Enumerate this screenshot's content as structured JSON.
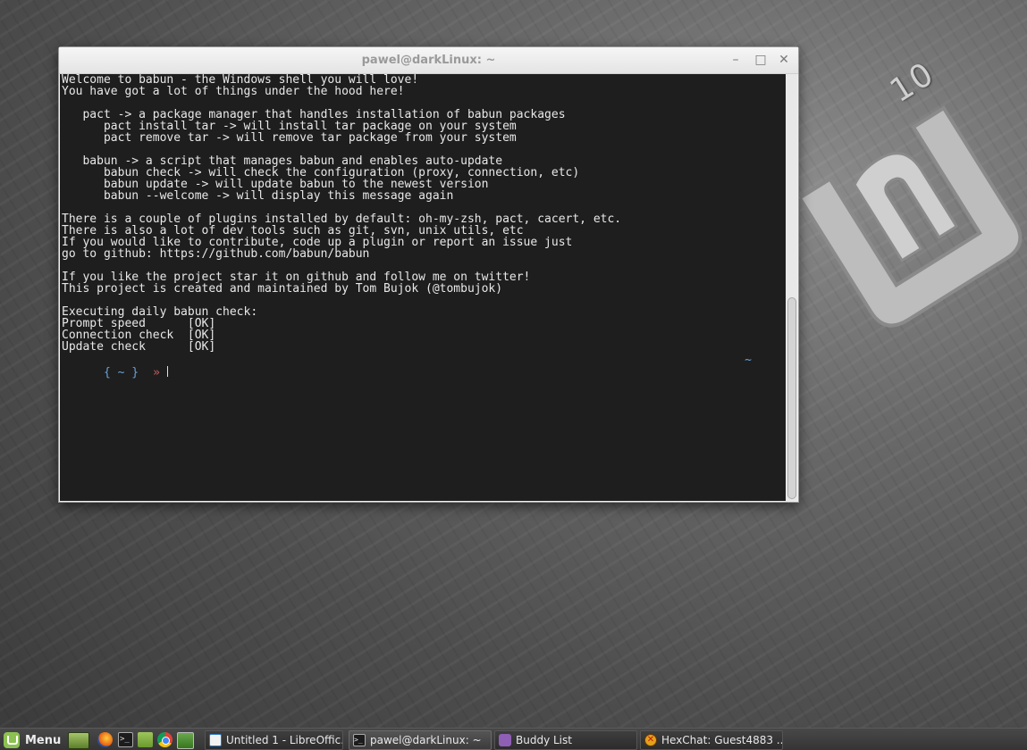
{
  "desktop": {
    "logo_version": "10"
  },
  "window": {
    "title": "pawel@darkLinux: ~",
    "buttons": {
      "minimize": "–",
      "maximize": "□",
      "close": "✕"
    }
  },
  "terminal": {
    "lines": [
      "Welcome to babun - the Windows shell you will love!",
      "You have got a lot of things under the hood here!",
      "",
      "   pact -> a package manager that handles installation of babun packages",
      "      pact install tar -> will install tar package on your system",
      "      pact remove tar -> will remove tar package from your system",
      "",
      "   babun -> a script that manages babun and enables auto-update",
      "      babun check -> will check the configuration (proxy, connection, etc)",
      "      babun update -> will update babun to the newest version",
      "      babun --welcome -> will display this message again",
      "",
      "There is a couple of plugins installed by default: oh-my-zsh, pact, cacert, etc.",
      "There is also a lot of dev tools such as git, svn, unix utils, etc",
      "If you would like to contribute, code up a plugin or report an issue just",
      "go to github: https://github.com/babun/babun",
      "",
      "If you like the project star it on github and follow me on twitter!",
      "This project is created and maintained by Tom Bujok (@tombujok)",
      "",
      "Executing daily babun check:",
      "Prompt speed      [OK]",
      "Connection check  [OK]",
      "Update check      [OK]"
    ],
    "prompt": {
      "dir": "{ ~ }",
      "arrow": "»",
      "right": "~"
    }
  },
  "taskbar": {
    "menu_label": "Menu",
    "launchers": [
      "show-desktop-icon",
      "firefox-icon",
      "terminal-icon",
      "files-icon",
      "chrome-icon",
      "app-icon"
    ],
    "terminal_launcher_glyph": ">_",
    "tasks": [
      {
        "label": "Untitled 1 - LibreOffic...",
        "icon": "libreoffice-doc-icon"
      },
      {
        "label": "pawel@darkLinux: ~",
        "icon": "terminal-icon"
      },
      {
        "label": "Buddy List",
        "icon": "pidgin-icon"
      },
      {
        "label": "HexChat: Guest4883 ...",
        "icon": "hexchat-icon"
      }
    ]
  }
}
